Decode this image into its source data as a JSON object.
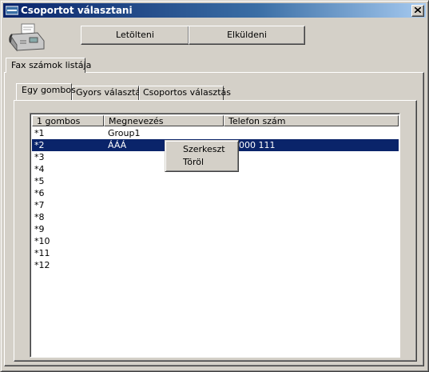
{
  "window": {
    "title": "Csoportot választani"
  },
  "toolbar": {
    "download_label": "Letölteni",
    "send_label": "Elküldeni"
  },
  "outer_tab": {
    "label": "Fax számok listája"
  },
  "inner_tabs": [
    {
      "label": "Egy gombos",
      "active": true
    },
    {
      "label": "Gyors választás",
      "active": false
    },
    {
      "label": "Csoportos választás",
      "active": false
    }
  ],
  "list": {
    "columns": [
      "1 gombos",
      "Megnevezés",
      "Telefon szám"
    ],
    "rows": [
      {
        "key": "*1",
        "name": "Group1",
        "phone": "",
        "selected": false
      },
      {
        "key": "*2",
        "name": "ÁÁÁ",
        "phone": "000 111",
        "selected": true
      },
      {
        "key": "*3",
        "name": "",
        "phone": "",
        "selected": false
      },
      {
        "key": "*4",
        "name": "",
        "phone": "",
        "selected": false
      },
      {
        "key": "*5",
        "name": "",
        "phone": "",
        "selected": false
      },
      {
        "key": "*6",
        "name": "",
        "phone": "",
        "selected": false
      },
      {
        "key": "*7",
        "name": "",
        "phone": "",
        "selected": false
      },
      {
        "key": "*8",
        "name": "",
        "phone": "",
        "selected": false
      },
      {
        "key": "*9",
        "name": "",
        "phone": "",
        "selected": false
      },
      {
        "key": "*10",
        "name": "",
        "phone": "",
        "selected": false
      },
      {
        "key": "*11",
        "name": "",
        "phone": "",
        "selected": false
      },
      {
        "key": "*12",
        "name": "",
        "phone": "",
        "selected": false
      }
    ]
  },
  "context_menu": {
    "items": [
      "Szerkeszt",
      "Töröl"
    ]
  },
  "icons": {
    "title": "fax-window-icon",
    "close": "close-icon",
    "app": "fax-machine-icon"
  },
  "colors": {
    "titlebar": "#0a246a",
    "selection": "#0a246a",
    "face": "#d4d0c8"
  }
}
